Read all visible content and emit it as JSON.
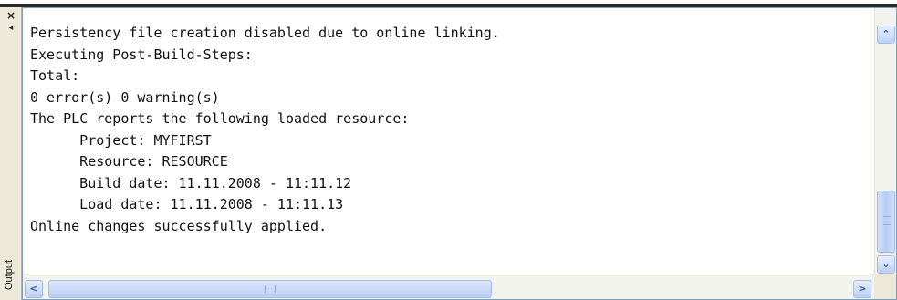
{
  "window": {
    "title": "Output",
    "close_glyph": "×",
    "pin_glyph": "◂"
  },
  "output": {
    "lines": [
      "Persistency file creation disabled due to online linking.",
      "Executing Post-Build-Steps:",
      "Total:",
      "0 error(s) 0 warning(s)",
      "The PLC reports the following loaded resource:",
      "      Project: MYFIRST",
      "      Resource: RESOURCE",
      "      Build date: 11.11.2008 - 11:11.12",
      "      Load date: 11.11.2008 - 11:11.13",
      "Online changes successfully applied."
    ]
  },
  "scrollbars": {
    "up_glyph": "⌃",
    "down_glyph": "⌄",
    "left_glyph": "<",
    "right_glyph": ">"
  },
  "icons": {
    "close": "close-icon",
    "pin": "pin-icon",
    "scroll_up": "chevron-up-icon",
    "scroll_down": "chevron-down-icon",
    "scroll_left": "chevron-left-icon",
    "scroll_right": "chevron-right-icon"
  },
  "colors": {
    "panel_border": "#7f9db9",
    "scrollbar_blue": "#bcd0f5",
    "rail": "#ece9d8"
  }
}
